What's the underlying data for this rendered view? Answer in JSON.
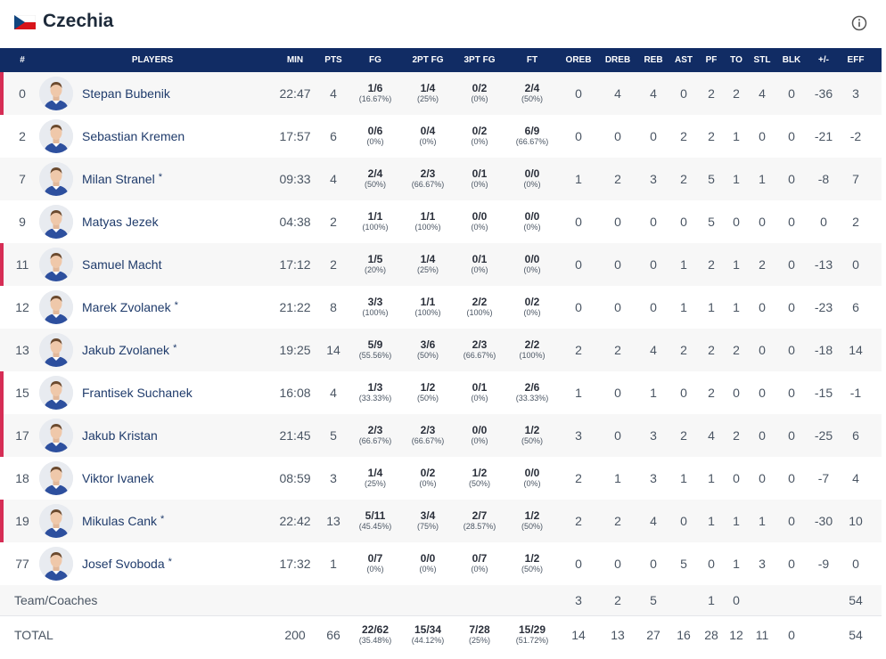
{
  "team": {
    "name": "Czechia"
  },
  "colors": {
    "header_bg": "#112c64",
    "accent": "#d62d55",
    "flag_white": "#ffffff",
    "flag_red": "#d7141a",
    "flag_blue": "#11457e"
  },
  "icons": {
    "flag": "czech-flag-icon",
    "info": "info-circle-icon"
  },
  "columns": {
    "num": "#",
    "players": "PLAYERS",
    "min": "MIN",
    "pts": "PTS",
    "fg": "FG",
    "fg2": "2PT FG",
    "fg3": "3PT FG",
    "ft": "FT",
    "oreb": "OREB",
    "dreb": "DREB",
    "reb": "REB",
    "ast": "AST",
    "pf": "PF",
    "to": "TO",
    "stl": "STL",
    "blk": "BLK",
    "pm": "+/-",
    "eff": "EFF"
  },
  "players": [
    {
      "num": "0",
      "name": "Stepan Bubenik",
      "star": "",
      "min": "22:47",
      "pts": "4",
      "fg": "1/6",
      "fg_pct": "(16.67%)",
      "fg2": "1/4",
      "fg2_pct": "(25%)",
      "fg3": "0/2",
      "fg3_pct": "(0%)",
      "ft": "2/4",
      "ft_pct": "(50%)",
      "oreb": "0",
      "dreb": "4",
      "reb": "4",
      "ast": "0",
      "pf": "2",
      "to": "2",
      "stl": "4",
      "blk": "0",
      "pm": "-36",
      "eff": "3"
    },
    {
      "num": "2",
      "name": "Sebastian Kremen",
      "star": "",
      "min": "17:57",
      "pts": "6",
      "fg": "0/6",
      "fg_pct": "(0%)",
      "fg2": "0/4",
      "fg2_pct": "(0%)",
      "fg3": "0/2",
      "fg3_pct": "(0%)",
      "ft": "6/9",
      "ft_pct": "(66.67%)",
      "oreb": "0",
      "dreb": "0",
      "reb": "0",
      "ast": "2",
      "pf": "2",
      "to": "1",
      "stl": "0",
      "blk": "0",
      "pm": "-21",
      "eff": "-2"
    },
    {
      "num": "7",
      "name": "Milan Stranel",
      "star": "*",
      "min": "09:33",
      "pts": "4",
      "fg": "2/4",
      "fg_pct": "(50%)",
      "fg2": "2/3",
      "fg2_pct": "(66.67%)",
      "fg3": "0/1",
      "fg3_pct": "(0%)",
      "ft": "0/0",
      "ft_pct": "(0%)",
      "oreb": "1",
      "dreb": "2",
      "reb": "3",
      "ast": "2",
      "pf": "5",
      "to": "1",
      "stl": "1",
      "blk": "0",
      "pm": "-8",
      "eff": "7"
    },
    {
      "num": "9",
      "name": "Matyas Jezek",
      "star": "",
      "min": "04:38",
      "pts": "2",
      "fg": "1/1",
      "fg_pct": "(100%)",
      "fg2": "1/1",
      "fg2_pct": "(100%)",
      "fg3": "0/0",
      "fg3_pct": "(0%)",
      "ft": "0/0",
      "ft_pct": "(0%)",
      "oreb": "0",
      "dreb": "0",
      "reb": "0",
      "ast": "0",
      "pf": "5",
      "to": "0",
      "stl": "0",
      "blk": "0",
      "pm": "0",
      "eff": "2"
    },
    {
      "num": "11",
      "name": "Samuel Macht",
      "star": "",
      "min": "17:12",
      "pts": "2",
      "fg": "1/5",
      "fg_pct": "(20%)",
      "fg2": "1/4",
      "fg2_pct": "(25%)",
      "fg3": "0/1",
      "fg3_pct": "(0%)",
      "ft": "0/0",
      "ft_pct": "(0%)",
      "oreb": "0",
      "dreb": "0",
      "reb": "0",
      "ast": "1",
      "pf": "2",
      "to": "1",
      "stl": "2",
      "blk": "0",
      "pm": "-13",
      "eff": "0"
    },
    {
      "num": "12",
      "name": "Marek Zvolanek",
      "star": "*",
      "min": "21:22",
      "pts": "8",
      "fg": "3/3",
      "fg_pct": "(100%)",
      "fg2": "1/1",
      "fg2_pct": "(100%)",
      "fg3": "2/2",
      "fg3_pct": "(100%)",
      "ft": "0/2",
      "ft_pct": "(0%)",
      "oreb": "0",
      "dreb": "0",
      "reb": "0",
      "ast": "1",
      "pf": "1",
      "to": "1",
      "stl": "0",
      "blk": "0",
      "pm": "-23",
      "eff": "6"
    },
    {
      "num": "13",
      "name": "Jakub Zvolanek",
      "star": "*",
      "min": "19:25",
      "pts": "14",
      "fg": "5/9",
      "fg_pct": "(55.56%)",
      "fg2": "3/6",
      "fg2_pct": "(50%)",
      "fg3": "2/3",
      "fg3_pct": "(66.67%)",
      "ft": "2/2",
      "ft_pct": "(100%)",
      "oreb": "2",
      "dreb": "2",
      "reb": "4",
      "ast": "2",
      "pf": "2",
      "to": "2",
      "stl": "0",
      "blk": "0",
      "pm": "-18",
      "eff": "14"
    },
    {
      "num": "15",
      "name": "Frantisek Suchanek",
      "star": "",
      "min": "16:08",
      "pts": "4",
      "fg": "1/3",
      "fg_pct": "(33.33%)",
      "fg2": "1/2",
      "fg2_pct": "(50%)",
      "fg3": "0/1",
      "fg3_pct": "(0%)",
      "ft": "2/6",
      "ft_pct": "(33.33%)",
      "oreb": "1",
      "dreb": "0",
      "reb": "1",
      "ast": "0",
      "pf": "2",
      "to": "0",
      "stl": "0",
      "blk": "0",
      "pm": "-15",
      "eff": "-1"
    },
    {
      "num": "17",
      "name": "Jakub Kristan",
      "star": "",
      "min": "21:45",
      "pts": "5",
      "fg": "2/3",
      "fg_pct": "(66.67%)",
      "fg2": "2/3",
      "fg2_pct": "(66.67%)",
      "fg3": "0/0",
      "fg3_pct": "(0%)",
      "ft": "1/2",
      "ft_pct": "(50%)",
      "oreb": "3",
      "dreb": "0",
      "reb": "3",
      "ast": "2",
      "pf": "4",
      "to": "2",
      "stl": "0",
      "blk": "0",
      "pm": "-25",
      "eff": "6"
    },
    {
      "num": "18",
      "name": "Viktor Ivanek",
      "star": "",
      "min": "08:59",
      "pts": "3",
      "fg": "1/4",
      "fg_pct": "(25%)",
      "fg2": "0/2",
      "fg2_pct": "(0%)",
      "fg3": "1/2",
      "fg3_pct": "(50%)",
      "ft": "0/0",
      "ft_pct": "(0%)",
      "oreb": "2",
      "dreb": "1",
      "reb": "3",
      "ast": "1",
      "pf": "1",
      "to": "0",
      "stl": "0",
      "blk": "0",
      "pm": "-7",
      "eff": "4"
    },
    {
      "num": "19",
      "name": "Mikulas Cank",
      "star": "*",
      "min": "22:42",
      "pts": "13",
      "fg": "5/11",
      "fg_pct": "(45.45%)",
      "fg2": "3/4",
      "fg2_pct": "(75%)",
      "fg3": "2/7",
      "fg3_pct": "(28.57%)",
      "ft": "1/2",
      "ft_pct": "(50%)",
      "oreb": "2",
      "dreb": "2",
      "reb": "4",
      "ast": "0",
      "pf": "1",
      "to": "1",
      "stl": "1",
      "blk": "0",
      "pm": "-30",
      "eff": "10"
    },
    {
      "num": "77",
      "name": "Josef Svoboda",
      "star": "*",
      "min": "17:32",
      "pts": "1",
      "fg": "0/7",
      "fg_pct": "(0%)",
      "fg2": "0/0",
      "fg2_pct": "(0%)",
      "fg3": "0/7",
      "fg3_pct": "(0%)",
      "ft": "1/2",
      "ft_pct": "(50%)",
      "oreb": "0",
      "dreb": "0",
      "reb": "0",
      "ast": "5",
      "pf": "0",
      "to": "1",
      "stl": "3",
      "blk": "0",
      "pm": "-9",
      "eff": "0"
    }
  ],
  "team_coaches": {
    "label": "Team/Coaches",
    "oreb": "3",
    "dreb": "2",
    "reb": "5",
    "pf": "1",
    "to": "0",
    "eff": "54"
  },
  "totals": {
    "label": "TOTAL",
    "min": "200",
    "pts": "66",
    "fg": "22/62",
    "fg_pct": "(35.48%)",
    "fg2": "15/34",
    "fg2_pct": "(44.12%)",
    "fg3": "7/28",
    "fg3_pct": "(25%)",
    "ft": "15/29",
    "ft_pct": "(51.72%)",
    "oreb": "14",
    "dreb": "13",
    "reb": "27",
    "ast": "16",
    "pf": "28",
    "to": "12",
    "stl": "11",
    "blk": "0",
    "eff": "54"
  }
}
